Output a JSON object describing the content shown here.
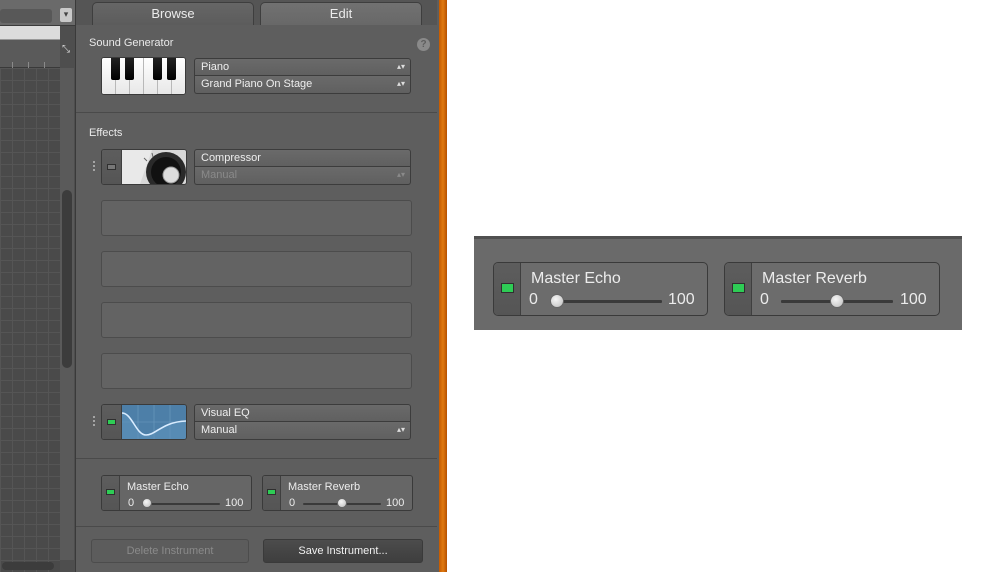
{
  "tabs": {
    "browse": "Browse",
    "edit": "Edit"
  },
  "help_glyph": "?",
  "sound_generator": {
    "title": "Sound Generator",
    "instrument": "Piano",
    "preset": "Grand Piano On Stage"
  },
  "effects": {
    "title": "Effects",
    "slot1": {
      "name": "Compressor",
      "preset": "Manual",
      "enabled": false,
      "preset_disabled": true
    },
    "slot6": {
      "name": "Visual EQ",
      "preset": "Manual",
      "enabled": true
    }
  },
  "master": {
    "echo": {
      "name": "Master Echo",
      "min": "0",
      "max": "100",
      "value": 0,
      "enabled": true
    },
    "reverb": {
      "name": "Master Reverb",
      "min": "0",
      "max": "100",
      "value": 50,
      "enabled": true
    }
  },
  "buttons": {
    "delete": "Delete Instrument",
    "save": "Save Instrument..."
  },
  "glyphs": {
    "updown": "▴▾",
    "resize": "⤡",
    "chevron_down": "▾"
  },
  "colors": {
    "led_on": "#2ecc55",
    "accent_orange": "#e07a10"
  }
}
